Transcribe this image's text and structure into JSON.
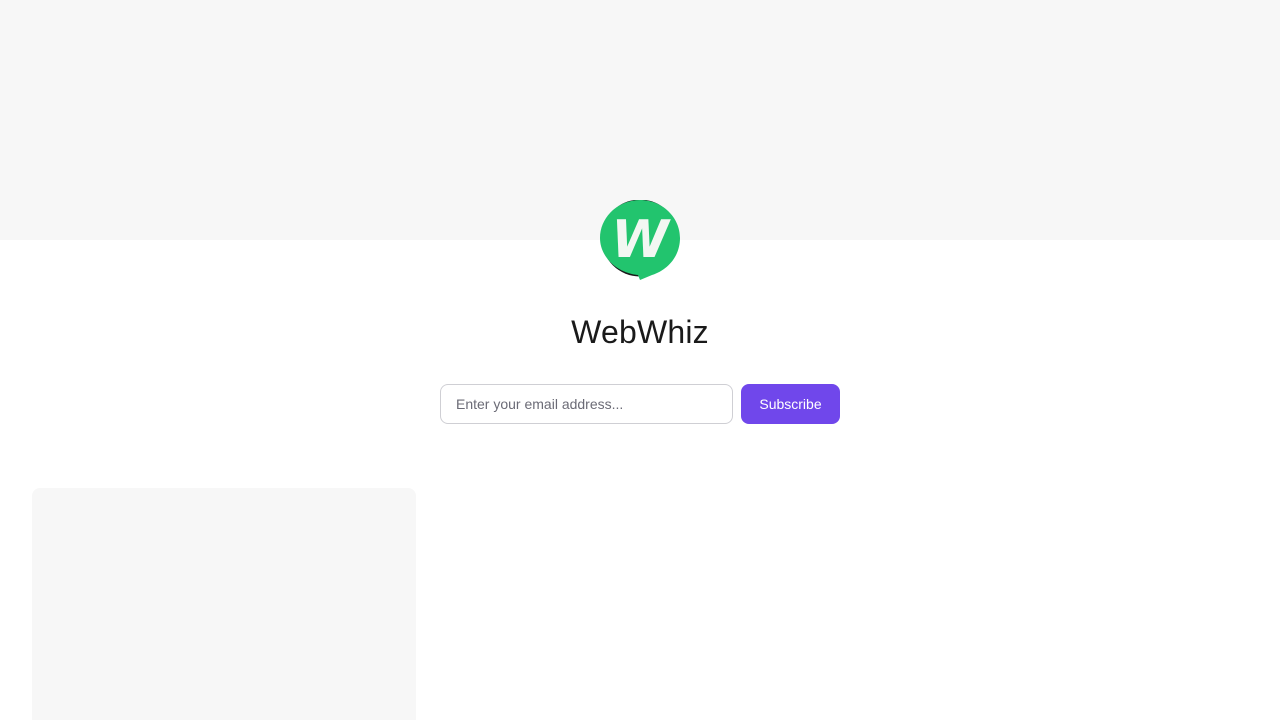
{
  "brand": {
    "name": "WebWhiz",
    "logo_icon": "webwhiz-logo-icon",
    "logo_color": "#22c46e",
    "logo_letter": "W"
  },
  "subscribe": {
    "email_placeholder": "Enter your email address...",
    "email_value": "",
    "button_label": "Subscribe",
    "button_color": "#7047eb"
  },
  "colors": {
    "cover_background": "#f7f7f7",
    "page_background": "#ffffff"
  }
}
